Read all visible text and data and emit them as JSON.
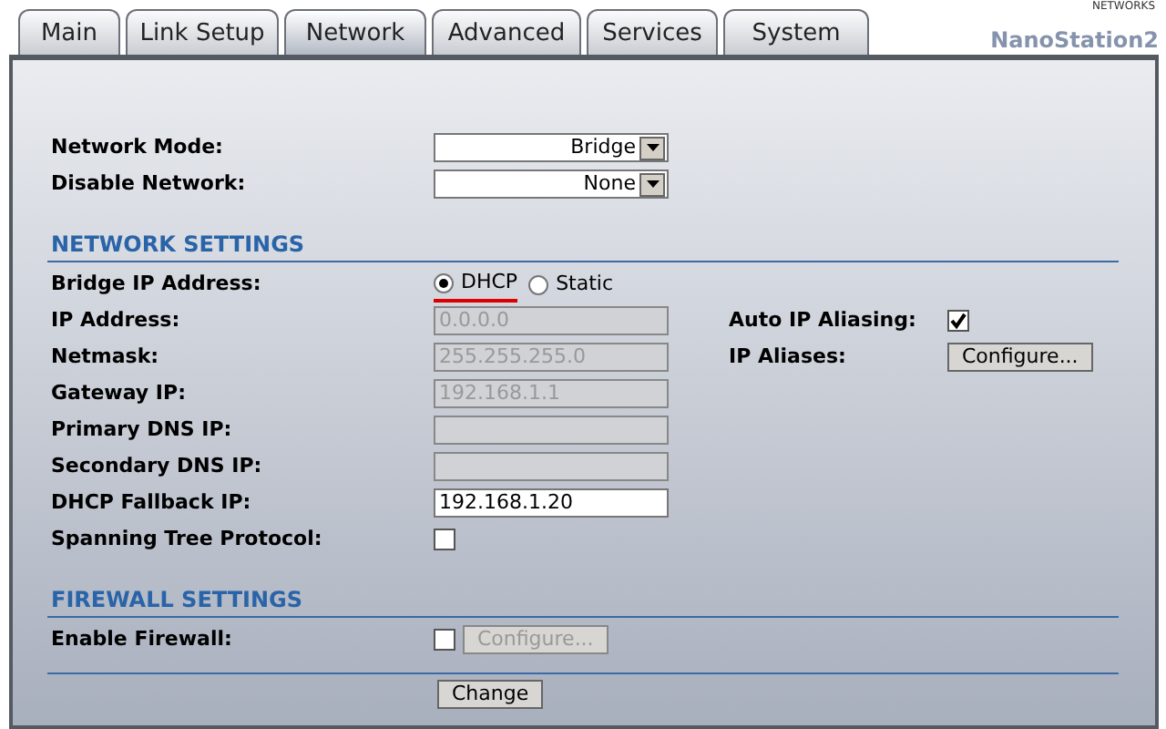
{
  "header": {
    "tabs": [
      {
        "label": "Main",
        "selected": false
      },
      {
        "label": "Link Setup",
        "selected": false
      },
      {
        "label": "Network",
        "selected": true
      },
      {
        "label": "Advanced",
        "selected": false
      },
      {
        "label": "Services",
        "selected": false
      },
      {
        "label": "System",
        "selected": false
      }
    ],
    "tagline": "NETWORKS",
    "brand": "NanoStation2"
  },
  "top_fields": [
    {
      "label": "Network Mode:",
      "kind": "select",
      "value": "Bridge"
    },
    {
      "label": "Disable Network:",
      "kind": "select",
      "value": "None"
    }
  ],
  "network_settings": {
    "title": "NETWORK SETTINGS",
    "rows": [
      {
        "label": "Bridge IP Address:",
        "kind": "radio",
        "options": [
          {
            "label": "DHCP",
            "selected": true,
            "underlined": true
          },
          {
            "label": "Static",
            "selected": false,
            "underlined": false
          }
        ]
      },
      {
        "label": "IP Address:",
        "kind": "text",
        "value": "0.0.0.0",
        "disabled": true
      },
      {
        "label": "Netmask:",
        "kind": "text",
        "value": "255.255.255.0",
        "disabled": true
      },
      {
        "label": "Gateway IP:",
        "kind": "text",
        "value": "192.168.1.1",
        "disabled": true
      },
      {
        "label": "Primary DNS IP:",
        "kind": "text",
        "disabled": true
      },
      {
        "label": "Secondary DNS IP:",
        "kind": "text",
        "disabled": true
      },
      {
        "label": "DHCP Fallback IP:",
        "kind": "text",
        "value": "192.168.1.20",
        "disabled": false
      },
      {
        "label": "Spanning Tree Protocol:",
        "kind": "checkbox",
        "checked": false
      }
    ],
    "side_rows": [
      {
        "label": "Auto IP Aliasing:",
        "kind": "checkbox",
        "checked": true
      },
      {
        "label": "IP Aliases:",
        "kind": "button",
        "button": "Configure...",
        "disabled": false
      }
    ]
  },
  "firewall_settings": {
    "title": "FIREWALL SETTINGS",
    "rows": [
      {
        "label": "Enable Firewall:",
        "kind": "checkbox_button",
        "checked": false,
        "button": "Configure...",
        "disabled": true
      }
    ]
  },
  "submit_button": "Change"
}
